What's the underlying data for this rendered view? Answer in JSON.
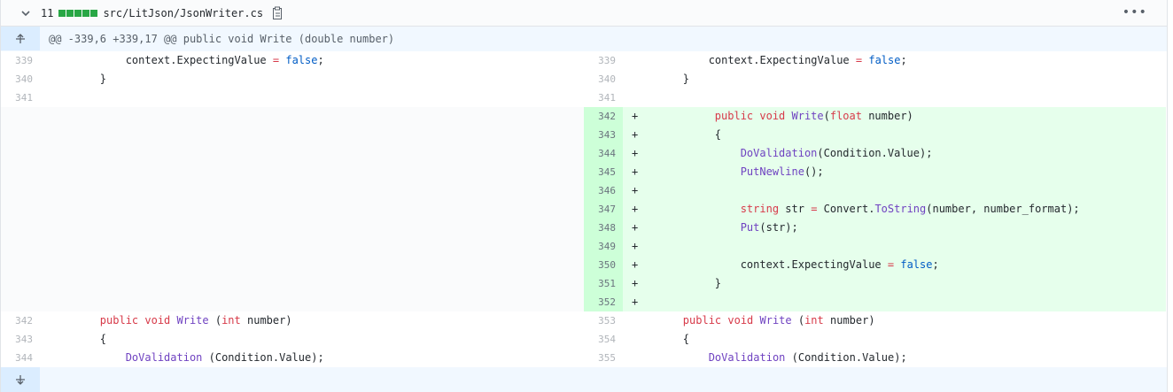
{
  "file": {
    "changes": "11",
    "path": "src/LitJson/JsonWriter.cs",
    "bar_color": "#28a745"
  },
  "hunk": "@@ -339,6 +339,17 @@ public void Write (double number)",
  "context_before": [
    {
      "l": "339",
      "r": "339",
      "indent": "            ",
      "parts": [
        [
          "context.ExpectingValue ",
          ""
        ],
        [
          "=",
          "k"
        ],
        [
          " ",
          ""
        ],
        [
          "false",
          "b"
        ],
        [
          ";",
          ""
        ]
      ]
    },
    {
      "l": "340",
      "r": "340",
      "indent": "        ",
      "parts": [
        [
          "}",
          ""
        ]
      ]
    },
    {
      "l": "341",
      "r": "341",
      "indent": "",
      "parts": []
    }
  ],
  "added": [
    {
      "r": "342",
      "indent": "        ",
      "parts": [
        [
          "public void ",
          "k"
        ],
        [
          "Write",
          "f"
        ],
        [
          "(",
          ""
        ],
        [
          "float",
          "k"
        ],
        [
          " number)",
          ""
        ]
      ]
    },
    {
      "r": "343",
      "indent": "        ",
      "parts": [
        [
          "{",
          ""
        ]
      ]
    },
    {
      "r": "344",
      "indent": "            ",
      "parts": [
        [
          "DoValidation",
          "f"
        ],
        [
          "(Condition.Value);",
          ""
        ]
      ]
    },
    {
      "r": "345",
      "indent": "            ",
      "parts": [
        [
          "PutNewline",
          "f"
        ],
        [
          "();",
          ""
        ]
      ]
    },
    {
      "r": "346",
      "indent": "",
      "parts": []
    },
    {
      "r": "347",
      "indent": "            ",
      "parts": [
        [
          "string",
          "k"
        ],
        [
          " str ",
          ""
        ],
        [
          "=",
          "k"
        ],
        [
          " Convert.",
          ""
        ],
        [
          "ToString",
          "f"
        ],
        [
          "(number, number_format);",
          ""
        ]
      ]
    },
    {
      "r": "348",
      "indent": "            ",
      "parts": [
        [
          "Put",
          "f"
        ],
        [
          "(str);",
          ""
        ]
      ]
    },
    {
      "r": "349",
      "indent": "",
      "parts": []
    },
    {
      "r": "350",
      "indent": "            ",
      "parts": [
        [
          "context.ExpectingValue ",
          ""
        ],
        [
          "=",
          "k"
        ],
        [
          " ",
          ""
        ],
        [
          "false",
          "b"
        ],
        [
          ";",
          ""
        ]
      ]
    },
    {
      "r": "351",
      "indent": "        ",
      "parts": [
        [
          "}",
          ""
        ]
      ]
    },
    {
      "r": "352",
      "indent": "",
      "parts": []
    }
  ],
  "context_after": [
    {
      "l": "342",
      "r": "353",
      "indent": "        ",
      "parts": [
        [
          "public void ",
          "k"
        ],
        [
          "Write",
          "f"
        ],
        [
          " (",
          ""
        ],
        [
          "int",
          "k"
        ],
        [
          " number)",
          ""
        ]
      ]
    },
    {
      "l": "343",
      "r": "354",
      "indent": "        ",
      "parts": [
        [
          "{",
          ""
        ]
      ]
    },
    {
      "l": "344",
      "r": "355",
      "indent": "            ",
      "parts": [
        [
          "DoValidation",
          "f"
        ],
        [
          " (Condition.Value);",
          ""
        ]
      ]
    }
  ]
}
